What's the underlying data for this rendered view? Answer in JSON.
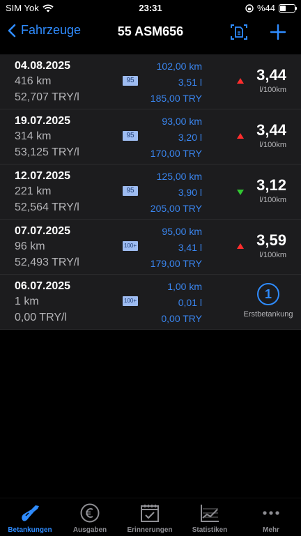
{
  "status_bar": {
    "carrier": "SIM Yok",
    "time": "23:31",
    "battery_text": "%44",
    "battery_level": 0.44
  },
  "navbar": {
    "back_label": "Fahrzeuge",
    "title": "55 ASM656"
  },
  "entries": [
    {
      "date": "04.08.2025",
      "distance": "416 km",
      "price": "52,707 TRY/l",
      "fuel": "95",
      "mid_km": "102,00 km",
      "mid_liters": "3,51 l",
      "mid_cost": "185,00 TRY",
      "trend": "up",
      "consumption": "3,44",
      "unit": "l/100km"
    },
    {
      "date": "19.07.2025",
      "distance": "314 km",
      "price": "53,125 TRY/l",
      "fuel": "95",
      "mid_km": "93,00 km",
      "mid_liters": "3,20 l",
      "mid_cost": "170,00 TRY",
      "trend": "up",
      "consumption": "3,44",
      "unit": "l/100km"
    },
    {
      "date": "12.07.2025",
      "distance": "221 km",
      "price": "52,564 TRY/l",
      "fuel": "95",
      "mid_km": "125,00 km",
      "mid_liters": "3,90 l",
      "mid_cost": "205,00 TRY",
      "trend": "down",
      "consumption": "3,12",
      "unit": "l/100km"
    },
    {
      "date": "07.07.2025",
      "distance": "96 km",
      "price": "52,493 TRY/l",
      "fuel": "100+",
      "mid_km": "95,00 km",
      "mid_liters": "3,41 l",
      "mid_cost": "179,00 TRY",
      "trend": "up",
      "consumption": "3,59",
      "unit": "l/100km"
    },
    {
      "date": "06.07.2025",
      "distance": "1 km",
      "price": "0,00 TRY/l",
      "fuel": "100+",
      "mid_km": "1,00 km",
      "mid_liters": "0,01 l",
      "mid_cost": "0,00 TRY",
      "first_badge": "1",
      "first_label": "Erstbetankung"
    }
  ],
  "tabs": [
    {
      "label": "Betankungen",
      "icon": "fuel-nozzle-icon",
      "active": true
    },
    {
      "label": "Ausgaben",
      "icon": "euro-icon"
    },
    {
      "label": "Erinnerungen",
      "icon": "calendar-check-icon"
    },
    {
      "label": "Statistiken",
      "icon": "chart-icon"
    },
    {
      "label": "Mehr",
      "icon": "ellipsis-icon"
    }
  ],
  "colors": {
    "accent": "#2f8cff",
    "trend_up": "#ff2d2d",
    "trend_down": "#32c832",
    "row_bg": "#1c1c1e",
    "fuel_badge": "#9ebcf1"
  }
}
